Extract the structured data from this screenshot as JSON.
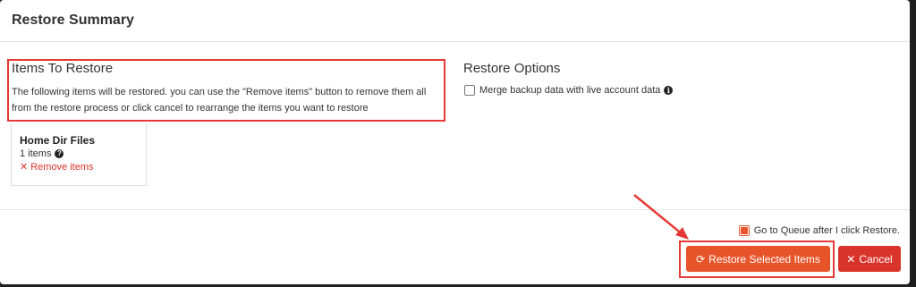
{
  "modal": {
    "title": "Restore Summary"
  },
  "items_to_restore": {
    "title": "Items To Restore",
    "description": "The following items will be restored. you can use the \"Remove items\" button to remove them all from the restore process or click cancel to rearrange the items you want to restore"
  },
  "home_dir": {
    "title": "Home Dir Files",
    "count": "1 items",
    "remove_label": "Remove items"
  },
  "restore_options": {
    "title": "Restore Options",
    "merge_label": "Merge backup data with live account data",
    "merge_checked": false
  },
  "footer": {
    "queue_label": "Go to Queue after I click Restore.",
    "queue_checked": true,
    "restore_button": "Restore Selected Items",
    "cancel_button": "Cancel"
  },
  "colors": {
    "accent": "#e8542a",
    "danger": "#d9342b",
    "highlight": "#e53935"
  }
}
